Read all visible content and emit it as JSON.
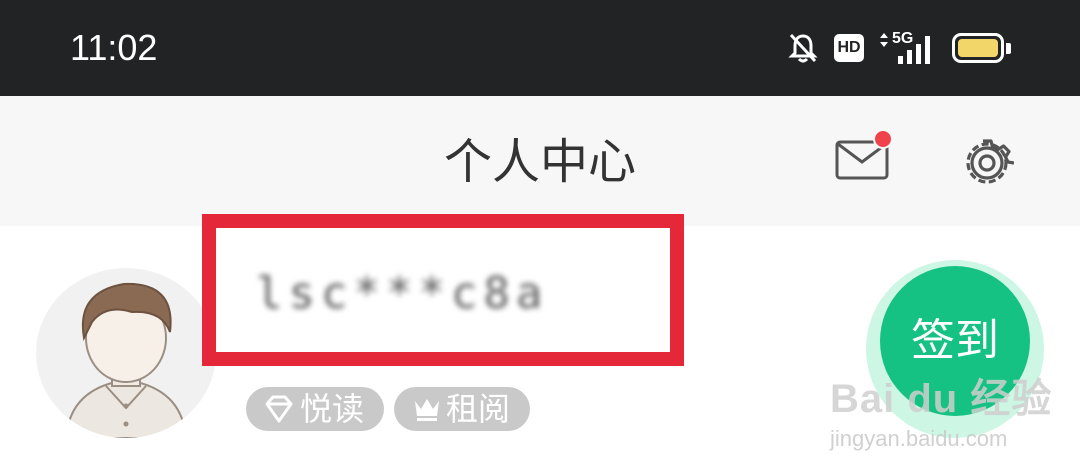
{
  "status_bar": {
    "time": "11:02",
    "hd_label": "HD",
    "network_label": "5G",
    "icons": [
      "bell-off-icon",
      "hd-icon",
      "signal-icon",
      "battery-icon"
    ],
    "battery_color": "#f2d66a"
  },
  "header": {
    "title": "个人中心",
    "icons": [
      "mail-icon",
      "gear-icon"
    ],
    "notification_dot_color": "#f0424a"
  },
  "profile": {
    "username": "lsc***c8a",
    "badges": [
      {
        "label": "悦读",
        "icon": "diamond-icon"
      },
      {
        "label": "租阅",
        "icon": "crown-icon"
      }
    ],
    "highlight_color": "#e4283a"
  },
  "checkin": {
    "label": "签到",
    "color": "#15c283"
  },
  "watermark": {
    "brand": "Bai  du 经验",
    "url": "jingyan.baidu.com"
  }
}
